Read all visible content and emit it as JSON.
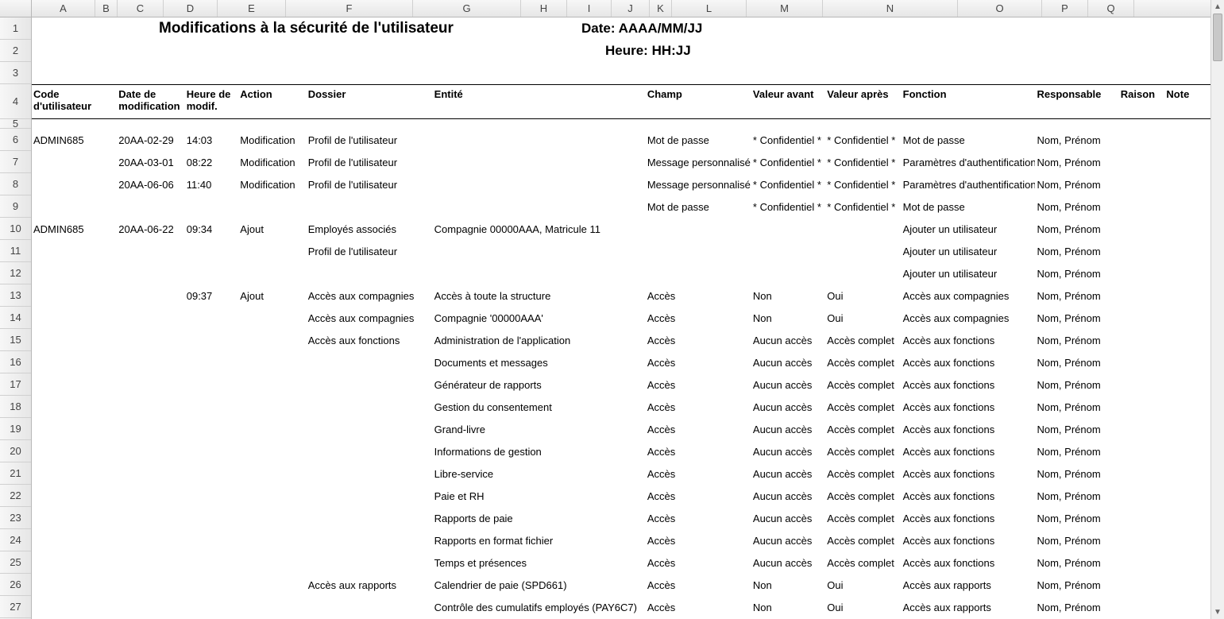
{
  "columns": [
    "A",
    "B",
    "C",
    "D",
    "E",
    "F",
    "G",
    "H",
    "I",
    "J",
    "K",
    "L",
    "M",
    "N",
    "O",
    "P",
    "Q"
  ],
  "row_numbers": [
    1,
    2,
    3,
    4,
    5,
    6,
    7,
    8,
    9,
    10,
    11,
    12,
    13,
    14,
    15,
    16,
    17,
    18,
    19,
    20,
    21,
    22,
    23,
    24,
    25,
    26,
    27
  ],
  "title": "Modifications à la sécurité de l'utilisateur",
  "date_label": "Date: AAAA/MM/JJ",
  "heure_label": "Heure: HH:JJ",
  "headers": {
    "code": "Code d'utilisateur",
    "datemod": "Date de modification",
    "heuremod": "Heure de modif.",
    "action": "Action",
    "dossier": "Dossier",
    "entite": "Entité",
    "champ": "Champ",
    "avant": "Valeur avant",
    "apres": "Valeur après",
    "fonction": "Fonction",
    "resp": "Responsable",
    "raison": "Raison",
    "note": "Note"
  },
  "rows": [
    {
      "code": "ADMIN685",
      "date": "20AA-02-29",
      "heure": "14:03",
      "action": "Modification",
      "dossier": "Profil de l'utilisateur",
      "entite": "",
      "champ": "Mot de passe",
      "avant": "* Confidentiel *",
      "apres": "* Confidentiel *",
      "fonction": "Mot de passe",
      "resp": "Nom, Prénom"
    },
    {
      "code": "",
      "date": "20AA-03-01",
      "heure": "08:22",
      "action": "Modification",
      "dossier": "Profil de l'utilisateur",
      "entite": "",
      "champ": "Message personnalisé",
      "avant": "* Confidentiel *",
      "apres": "* Confidentiel *",
      "fonction": "Paramètres d'authentification",
      "resp": "Nom, Prénom"
    },
    {
      "code": "",
      "date": "20AA-06-06",
      "heure": "11:40",
      "action": "Modification",
      "dossier": "Profil de l'utilisateur",
      "entite": "",
      "champ": "Message personnalisé",
      "avant": "* Confidentiel *",
      "apres": "* Confidentiel *",
      "fonction": "Paramètres d'authentification",
      "resp": "Nom, Prénom"
    },
    {
      "code": "",
      "date": "",
      "heure": "",
      "action": "",
      "dossier": "",
      "entite": "",
      "champ": "Mot de passe",
      "avant": "* Confidentiel *",
      "apres": "* Confidentiel *",
      "fonction": "Mot de passe",
      "resp": "Nom, Prénom"
    },
    {
      "code": "ADMIN685",
      "date": "20AA-06-22",
      "heure": "09:34",
      "action": "Ajout",
      "dossier": "Employés associés",
      "entite": "Compagnie 00000AAA, Matricule 11",
      "champ": "",
      "avant": "",
      "apres": "",
      "fonction": "Ajouter un utilisateur",
      "resp": "Nom, Prénom"
    },
    {
      "code": "",
      "date": "",
      "heure": "",
      "action": "",
      "dossier": "Profil de l'utilisateur",
      "entite": "",
      "champ": "",
      "avant": "",
      "apres": "",
      "fonction": "Ajouter un utilisateur",
      "resp": "Nom, Prénom"
    },
    {
      "code": "",
      "date": "",
      "heure": "",
      "action": "",
      "dossier": "",
      "entite": "",
      "champ": "",
      "avant": "",
      "apres": "",
      "fonction": "Ajouter un utilisateur",
      "resp": "Nom, Prénom"
    },
    {
      "code": "",
      "date": "",
      "heure": "09:37",
      "action": "Ajout",
      "dossier": "Accès aux compagnies",
      "entite": "Accès à toute la structure",
      "champ": "Accès",
      "avant": "Non",
      "apres": "Oui",
      "fonction": "Accès aux compagnies",
      "resp": "Nom, Prénom"
    },
    {
      "code": "",
      "date": "",
      "heure": "",
      "action": "",
      "dossier": "Accès aux compagnies",
      "entite": "Compagnie '00000AAA'",
      "champ": "Accès",
      "avant": "Non",
      "apres": "Oui",
      "fonction": "Accès aux compagnies",
      "resp": "Nom, Prénom"
    },
    {
      "code": "",
      "date": "",
      "heure": "",
      "action": "",
      "dossier": "Accès aux fonctions",
      "entite": "Administration de l'application",
      "champ": "Accès",
      "avant": "Aucun accès",
      "apres": "Accès complet",
      "fonction": "Accès aux fonctions",
      "resp": "Nom, Prénom"
    },
    {
      "code": "",
      "date": "",
      "heure": "",
      "action": "",
      "dossier": "",
      "entite": "Documents et messages",
      "champ": "Accès",
      "avant": "Aucun accès",
      "apres": "Accès complet",
      "fonction": "Accès aux fonctions",
      "resp": "Nom, Prénom"
    },
    {
      "code": "",
      "date": "",
      "heure": "",
      "action": "",
      "dossier": "",
      "entite": "Générateur de rapports",
      "champ": "Accès",
      "avant": "Aucun accès",
      "apres": "Accès complet",
      "fonction": "Accès aux fonctions",
      "resp": "Nom, Prénom"
    },
    {
      "code": "",
      "date": "",
      "heure": "",
      "action": "",
      "dossier": "",
      "entite": "Gestion du consentement",
      "champ": "Accès",
      "avant": "Aucun accès",
      "apres": "Accès complet",
      "fonction": "Accès aux fonctions",
      "resp": "Nom, Prénom"
    },
    {
      "code": "",
      "date": "",
      "heure": "",
      "action": "",
      "dossier": "",
      "entite": "Grand-livre",
      "champ": "Accès",
      "avant": "Aucun accès",
      "apres": "Accès complet",
      "fonction": "Accès aux fonctions",
      "resp": "Nom, Prénom"
    },
    {
      "code": "",
      "date": "",
      "heure": "",
      "action": "",
      "dossier": "",
      "entite": "Informations de gestion",
      "champ": "Accès",
      "avant": "Aucun accès",
      "apres": "Accès complet",
      "fonction": "Accès aux fonctions",
      "resp": "Nom, Prénom"
    },
    {
      "code": "",
      "date": "",
      "heure": "",
      "action": "",
      "dossier": "",
      "entite": "Libre-service",
      "champ": "Accès",
      "avant": "Aucun accès",
      "apres": "Accès complet",
      "fonction": "Accès aux fonctions",
      "resp": "Nom, Prénom"
    },
    {
      "code": "",
      "date": "",
      "heure": "",
      "action": "",
      "dossier": "",
      "entite": "Paie et RH",
      "champ": "Accès",
      "avant": "Aucun accès",
      "apres": "Accès complet",
      "fonction": "Accès aux fonctions",
      "resp": "Nom, Prénom"
    },
    {
      "code": "",
      "date": "",
      "heure": "",
      "action": "",
      "dossier": "",
      "entite": "Rapports de paie",
      "champ": "Accès",
      "avant": "Aucun accès",
      "apres": "Accès complet",
      "fonction": "Accès aux fonctions",
      "resp": "Nom, Prénom"
    },
    {
      "code": "",
      "date": "",
      "heure": "",
      "action": "",
      "dossier": "",
      "entite": "Rapports en format fichier",
      "champ": "Accès",
      "avant": "Aucun accès",
      "apres": "Accès complet",
      "fonction": "Accès aux fonctions",
      "resp": "Nom, Prénom"
    },
    {
      "code": "",
      "date": "",
      "heure": "",
      "action": "",
      "dossier": "",
      "entite": "Temps et présences",
      "champ": "Accès",
      "avant": "Aucun accès",
      "apres": "Accès complet",
      "fonction": "Accès aux fonctions",
      "resp": "Nom, Prénom"
    },
    {
      "code": "",
      "date": "",
      "heure": "",
      "action": "",
      "dossier": "Accès aux rapports",
      "entite": "Calendrier de paie (SPD661)",
      "champ": "Accès",
      "avant": "Non",
      "apres": "Oui",
      "fonction": "Accès aux rapports",
      "resp": "Nom, Prénom"
    },
    {
      "code": "",
      "date": "",
      "heure": "",
      "action": "",
      "dossier": "",
      "entite": "Contrôle des cumulatifs employés (PAY6C7)",
      "champ": "Accès",
      "avant": "Non",
      "apres": "Oui",
      "fonction": "Accès aux rapports",
      "resp": "Nom, Prénom"
    }
  ]
}
